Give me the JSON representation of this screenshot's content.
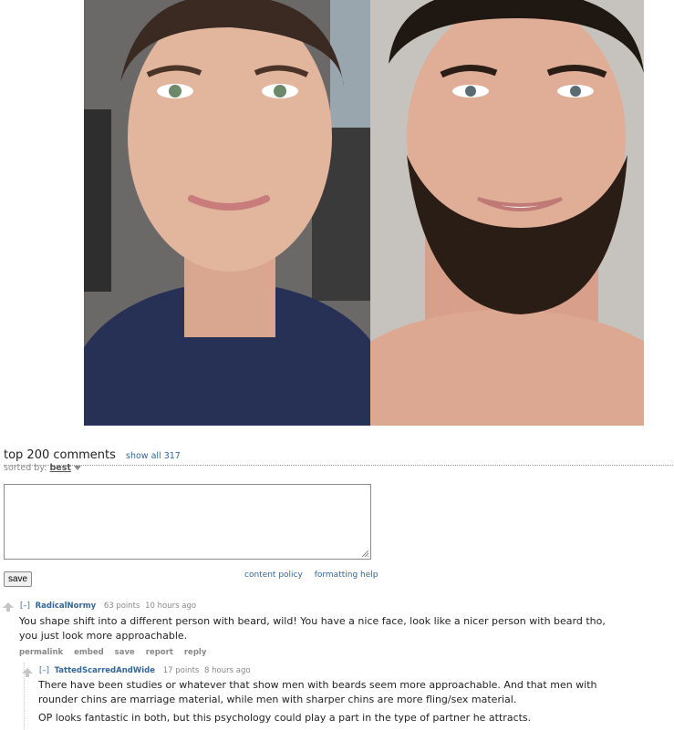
{
  "post_image": {
    "alt": ""
  },
  "comments_header": {
    "title": "top 200 comments",
    "show_all": "show all 317",
    "sorted_by_label": "sorted by:",
    "sorted_by_value": "best"
  },
  "editor": {
    "textarea_value": "",
    "save_label": "save",
    "content_policy": "content policy",
    "formatting_help": "formatting help"
  },
  "comments": [
    {
      "expand": "[–]",
      "author": "RadicalNormy",
      "points": "63 points",
      "time": "10 hours ago",
      "body": [
        "You shape shift into a different person with beard, wild! You have a nice face, look like a nicer person with beard tho,",
        "you just look more approachable."
      ],
      "buttons": [
        "permalink",
        "embed",
        "save",
        "report",
        "reply"
      ]
    },
    {
      "expand": "[–]",
      "author": "TattedScarredAndWide",
      "points": "17 points",
      "time": "8 hours ago",
      "body": [
        "There have been studies or whatever that show men with beards seem more approachable. And that men with",
        "rounder chins are marriage material, while men with sharper chins are more fling/sex material.",
        "OP looks fantastic in both, but this psychology could play a part in the type of partner he attracts."
      ]
    }
  ],
  "colors": {
    "link": "#336699",
    "muted": "#888888",
    "text": "#222222"
  }
}
